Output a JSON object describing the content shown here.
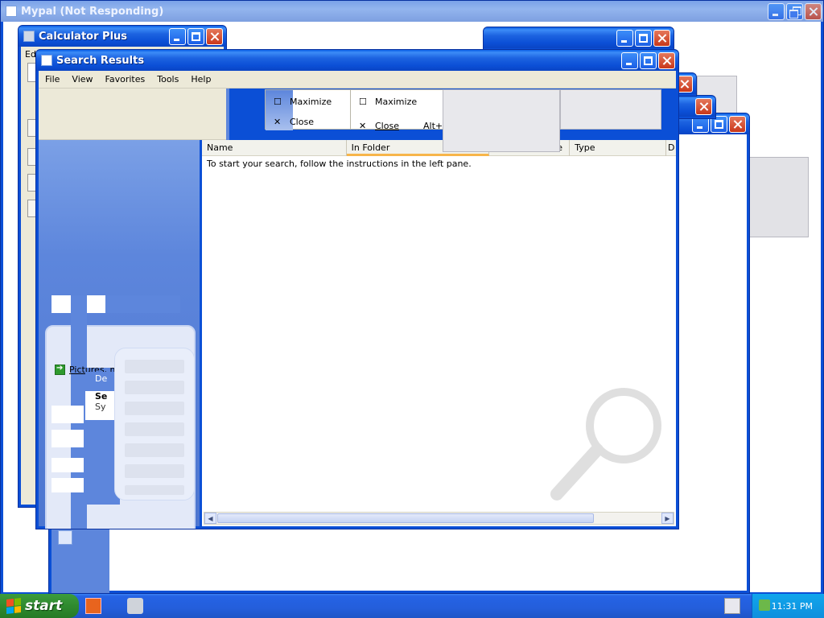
{
  "mypal": {
    "title": "Mypal (Not Responding)"
  },
  "calculator": {
    "title": "Calculator Plus",
    "menu_partial": "Edi"
  },
  "search_results": {
    "title": "Search Results",
    "menu": [
      "File",
      "View",
      "Favorites",
      "Tools",
      "Help"
    ],
    "left_pane": {
      "link_label": "Pictures, music, or video",
      "partial_labels": [
        "De",
        "Se",
        "Sy"
      ]
    },
    "columns": [
      "Name",
      "In Folder",
      "e",
      "Type",
      "D"
    ],
    "hint": "To start your search, follow the instructions in the left pane."
  },
  "context_menus": [
    {
      "items": [
        "Maximize",
        "Close"
      ]
    },
    {
      "items": [
        "Maximize",
        "Close"
      ],
      "extra": "Alt+"
    }
  ],
  "taskbar": {
    "start_label": "start",
    "clock": "11:31 PM"
  },
  "colors": {
    "titlebar": "#0b4fd6",
    "leftpane": "#5d86dc",
    "start_green": "#2f8a2f",
    "taskbar": "#245edb",
    "tray": "#0f8fdd"
  }
}
